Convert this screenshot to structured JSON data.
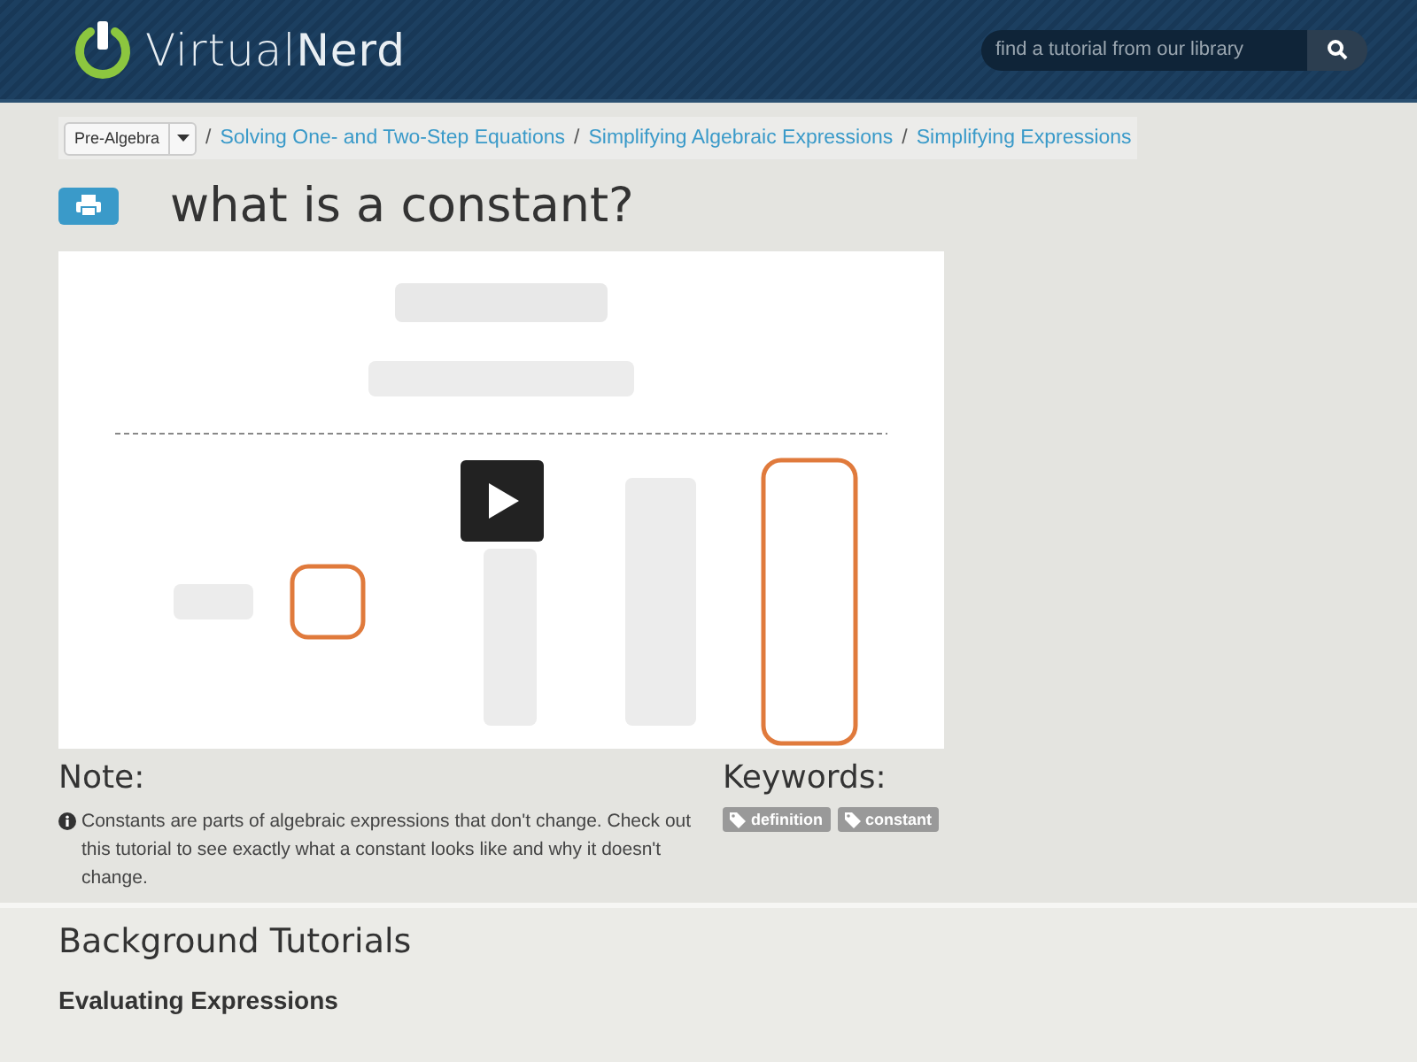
{
  "header": {
    "logo": "Virtual**Nerd**",
    "search": {
      "placeholder": "find a tutorial from our library"
    }
  },
  "breadcrumb": {
    "subject": "Pre-Algebra",
    "separator": "/",
    "links": [
      "Solving One- and Two-Step Equations",
      "Simplifying Algebraic Expressions",
      "Simplifying Expressions"
    ]
  },
  "title": "what is a constant?",
  "note": {
    "heading": "Note:",
    "text": "Constants are parts of algebraic expressions that don't change. Check out this tutorial to see exactly what a constant looks like and why it doesn't change."
  },
  "keywords": {
    "heading": "Keywords:",
    "tags": [
      "definition",
      "constant"
    ]
  },
  "background": {
    "heading": "Background Tutorials",
    "items": [
      "Evaluating Expressions"
    ]
  }
}
